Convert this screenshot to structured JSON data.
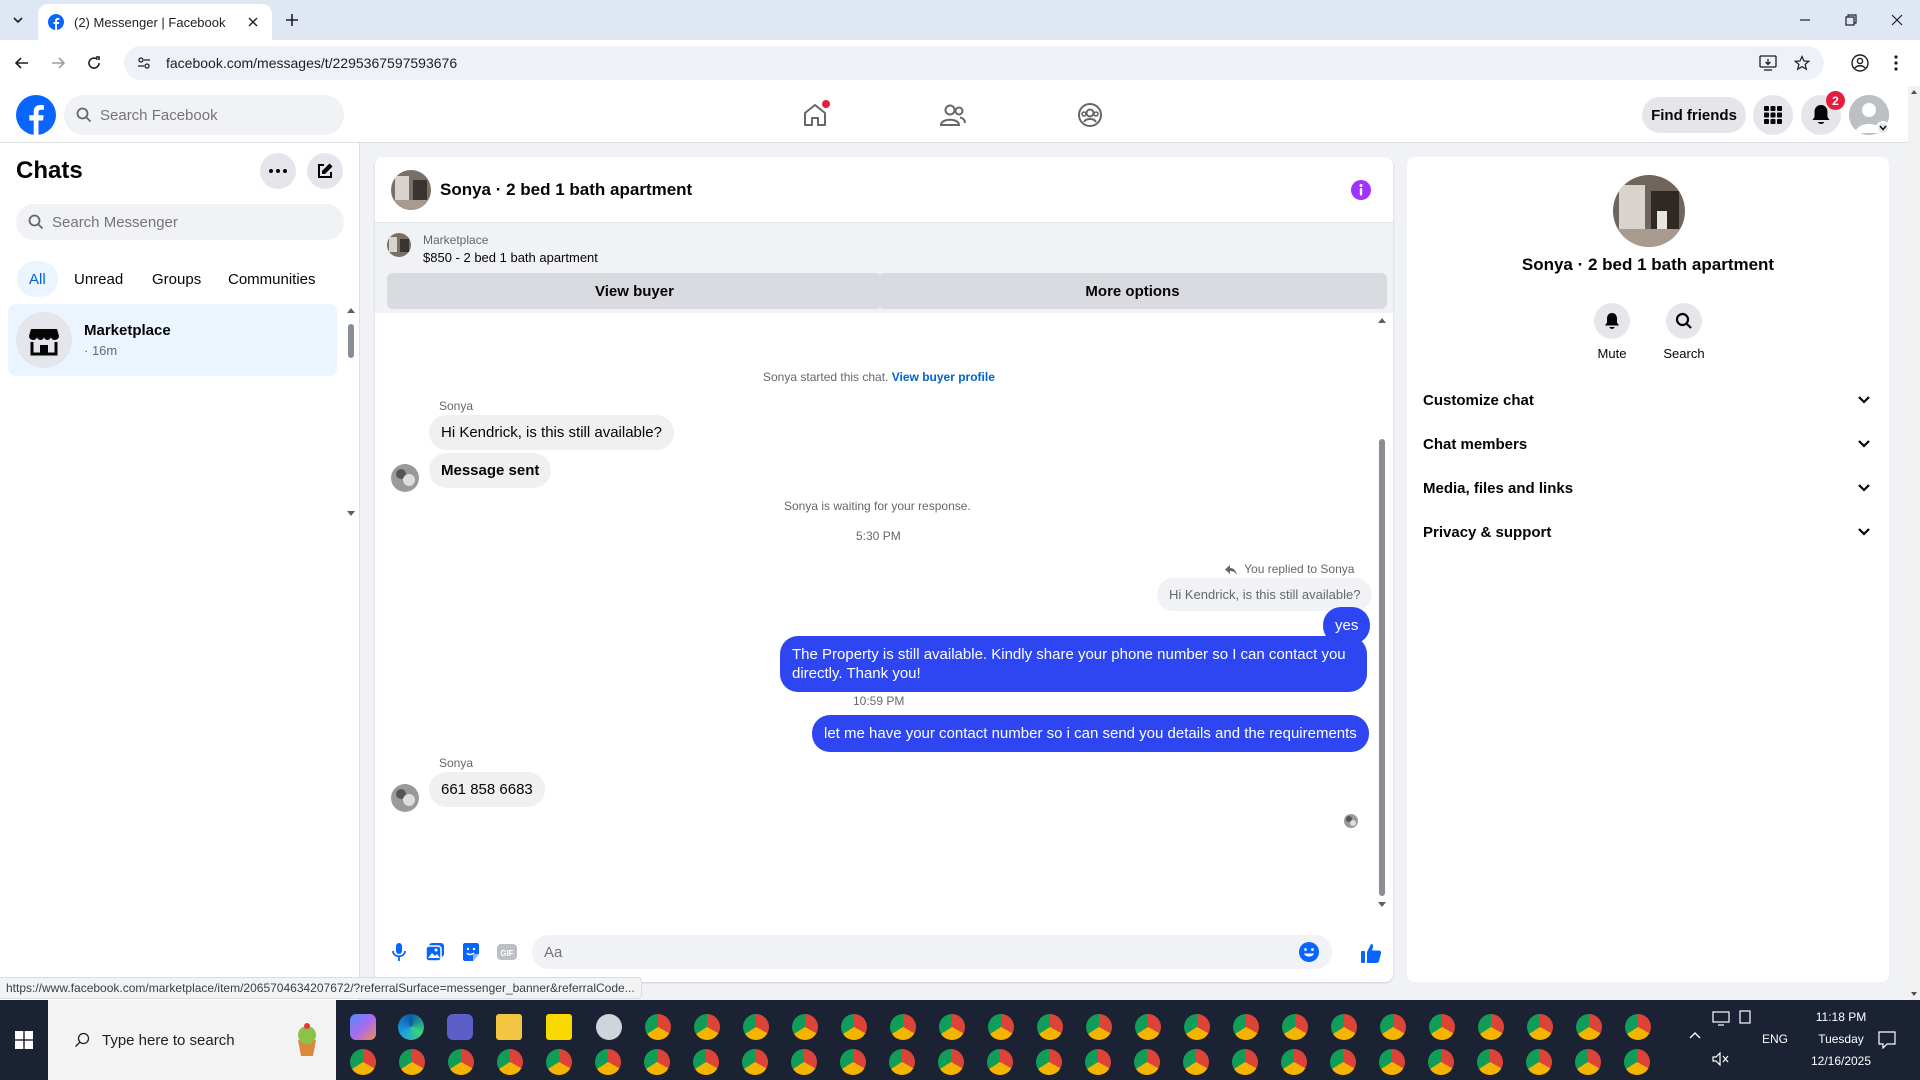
{
  "browser": {
    "tab_title": "(2) Messenger | Facebook",
    "url": "facebook.com/messages/t/2295367597593676",
    "status_url": "https://www.facebook.com/marketplace/item/2065704634207672/?referralSurface=messenger_banner&referralCode..."
  },
  "header": {
    "search_placeholder": "Search Facebook",
    "find_friends_label": "Find friends",
    "notification_count": "2"
  },
  "chats": {
    "title": "Chats",
    "search_placeholder": "Search Messenger",
    "filters": [
      "All",
      "Unread",
      "Groups",
      "Communities"
    ],
    "items": [
      {
        "name": "Marketplace",
        "time": "· 16m"
      }
    ]
  },
  "conversation": {
    "title": "Sonya · 2 bed 1 bath apartment",
    "banner": {
      "label": "Marketplace",
      "item": "$850 - 2 bed 1 bath apartment",
      "view_buyer": "View buyer",
      "more_options": "More options"
    },
    "started_text": "Sonya started this chat.",
    "view_buyer_profile": "View buyer profile",
    "sender_1": "Sonya",
    "msg_1": "Hi Kendrick, is this still available?",
    "msg_2": "Message sent",
    "waiting_text": "Sonya is waiting for your response.",
    "time_1": "5:30 PM",
    "reply_label": "You replied to Sonya",
    "reply_quote": "Hi Kendrick, is this still available?",
    "out_1": "yes",
    "out_2": "The Property is still available. Kindly share your phone number so I can contact you directly. Thank you!",
    "time_2": "10:59 PM",
    "out_3": "let me have your contact number so i can send you details and the requirements",
    "sender_2": "Sonya",
    "msg_3": "661 858 6683",
    "composer_placeholder": "Aa"
  },
  "info_panel": {
    "name": "Sonya · 2 bed 1 bath apartment",
    "mute_label": "Mute",
    "search_label": "Search",
    "sections": [
      "Customize chat",
      "Chat members",
      "Media, files and links",
      "Privacy & support"
    ]
  },
  "taskbar": {
    "search_placeholder": "Type here to search",
    "language": "ENG",
    "time": "11:18 PM",
    "day": "Tuesday",
    "date": "12/16/2025"
  },
  "colors": {
    "brand_blue": "#0866ff",
    "outgoing_bubble": "#2e46f2",
    "badge_red": "#e41e3f",
    "info_purple": "#a033ff"
  }
}
